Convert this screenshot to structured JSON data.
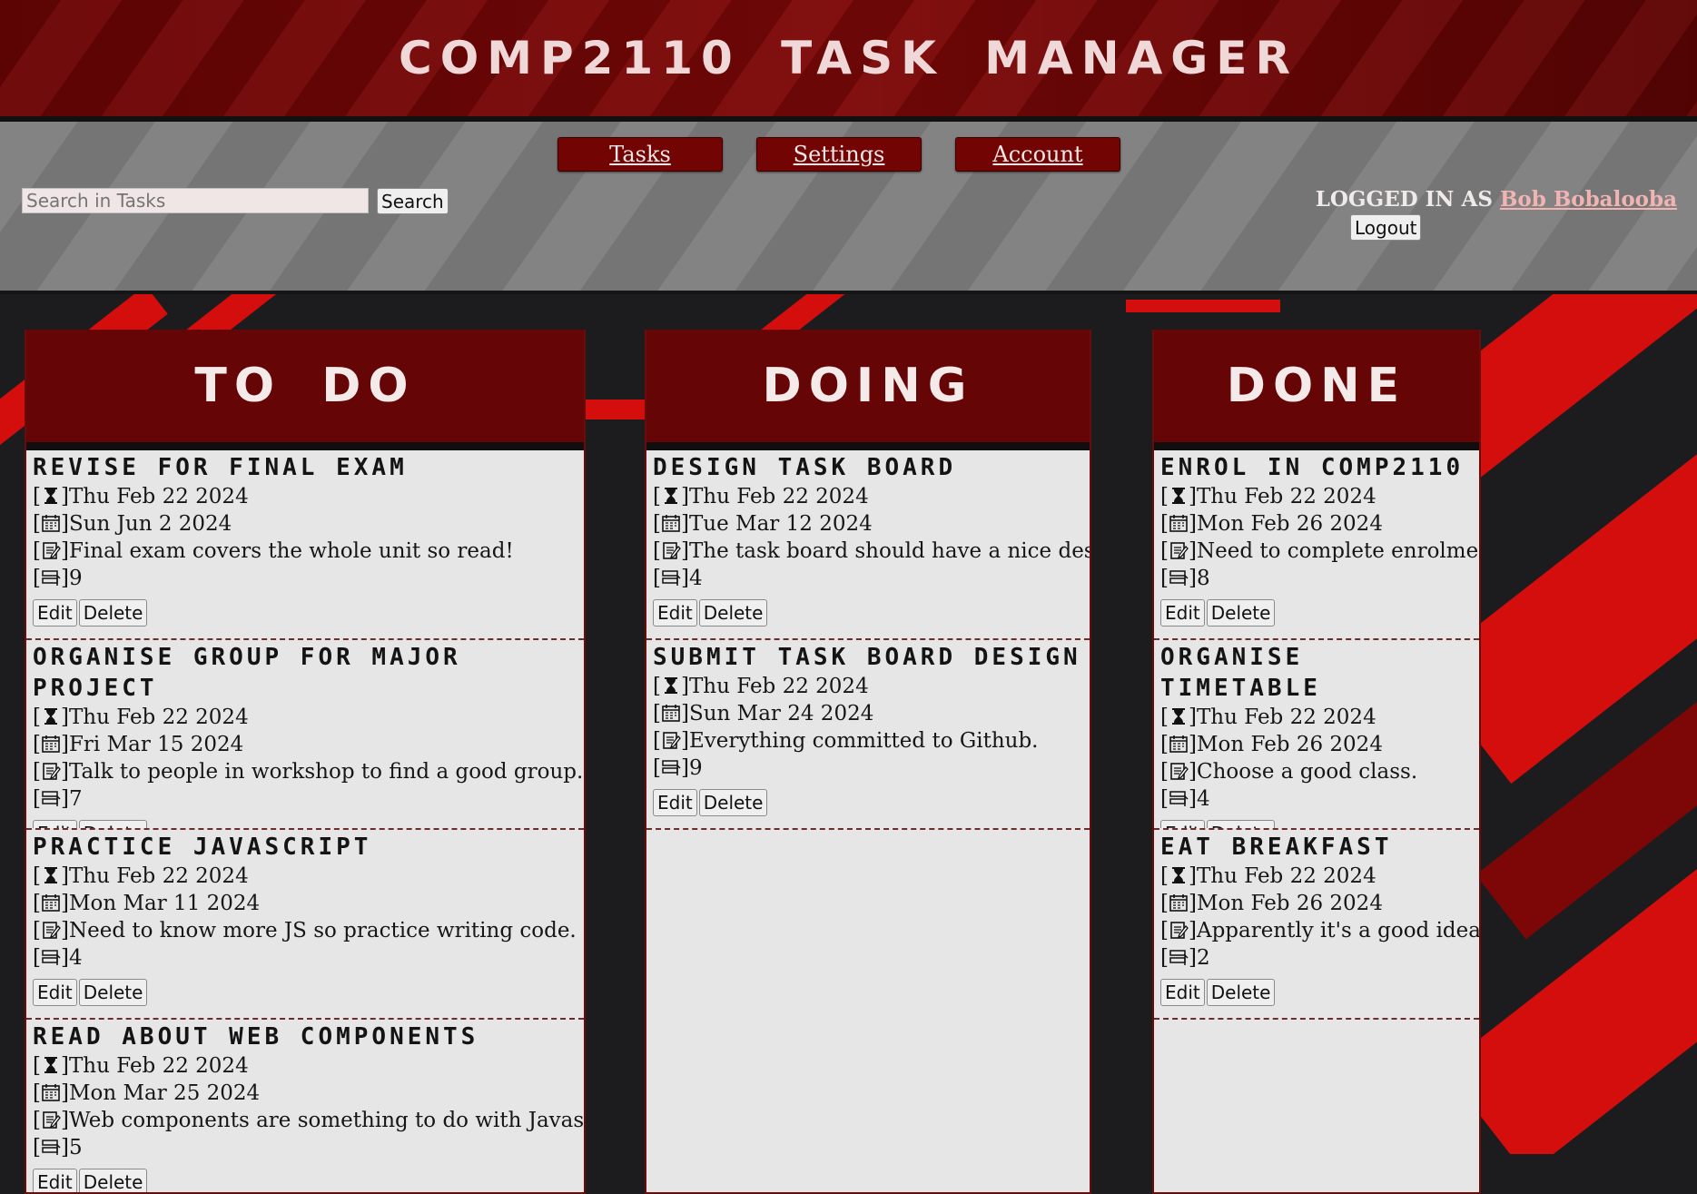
{
  "header": {
    "title": "COMP2110 TASK MANAGER"
  },
  "nav": {
    "tasks": "Tasks",
    "settings": "Settings",
    "account": "Account"
  },
  "search": {
    "placeholder": "Search in Tasks",
    "button": "Search"
  },
  "session": {
    "prefix": "LOGGED IN AS",
    "user": "Bob Bobalooba",
    "logout": "Logout"
  },
  "columns": [
    {
      "title": "TO DO",
      "tasks": [
        {
          "title": "REVISE FOR FINAL EXAM",
          "created": "Thu Feb 22 2024",
          "due": "Sun Jun 2 2024",
          "summary": "Final exam covers the whole unit so read!",
          "priority": "9"
        },
        {
          "title": "ORGANISE GROUP FOR MAJOR PROJECT",
          "created": "Thu Feb 22 2024",
          "due": "Fri Mar 15 2024",
          "summary": "Talk to people in workshop to find a good group.",
          "priority": "7"
        },
        {
          "title": "PRACTICE JAVASCRIPT",
          "created": "Thu Feb 22 2024",
          "due": "Mon Mar 11 2024",
          "summary": "Need to know more JS so practice writing code.",
          "priority": "4"
        },
        {
          "title": "READ ABOUT WEB COMPONENTS",
          "created": "Thu Feb 22 2024",
          "due": "Mon Mar 25 2024",
          "summary": "Web components are something to do with Javascript.",
          "priority": "5"
        }
      ]
    },
    {
      "title": "DOING",
      "tasks": [
        {
          "title": "DESIGN TASK BOARD",
          "created": "Thu Feb 22 2024",
          "due": "Tue Mar 12 2024",
          "summary": "The task board should have a nice design.",
          "priority": "4"
        },
        {
          "title": "SUBMIT TASK BOARD DESIGN",
          "created": "Thu Feb 22 2024",
          "due": "Sun Mar 24 2024",
          "summary": "Everything committed to Github.",
          "priority": "9"
        }
      ]
    },
    {
      "title": "DONE",
      "tasks": [
        {
          "title": "ENROL IN COMP2110",
          "created": "Thu Feb 22 2024",
          "due": "Mon Feb 26 2024",
          "summary": "Need to complete enrolment.",
          "priority": "8"
        },
        {
          "title": "ORGANISE TIMETABLE",
          "created": "Thu Feb 22 2024",
          "due": "Mon Feb 26 2024",
          "summary": "Choose a good class.",
          "priority": "4"
        },
        {
          "title": "EAT BREAKFAST",
          "created": "Thu Feb 22 2024",
          "due": "Mon Feb 26 2024",
          "summary": "Apparently it's a good idea.",
          "priority": "2"
        }
      ]
    }
  ],
  "card_actions": {
    "edit": "Edit",
    "delete": "Delete"
  },
  "icons": {
    "created": "hourglass-icon",
    "due": "calendar-icon",
    "summary": "notepad-icon",
    "priority": "priority-icon"
  },
  "colors": {
    "accent": "#720404",
    "column_bg": "#e6e6e6",
    "nav_bg": "#7b7b7b"
  }
}
